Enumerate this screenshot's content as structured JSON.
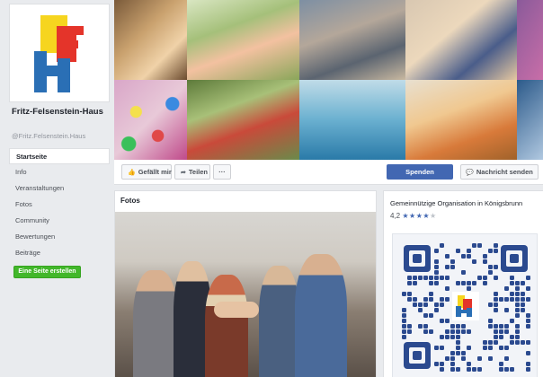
{
  "page": {
    "name": "Fritz-Felsenstein-Haus",
    "handle": "@Fritz.Felsenstein.Haus"
  },
  "nav": [
    {
      "label": "Startseite",
      "active": true
    },
    {
      "label": "Info"
    },
    {
      "label": "Veranstaltungen"
    },
    {
      "label": "Fotos"
    },
    {
      "label": "Community"
    },
    {
      "label": "Bewertungen"
    },
    {
      "label": "Beiträge"
    }
  ],
  "create_button": "Eine Seite erstellen",
  "actions": {
    "like": "Gefällt mir",
    "share": "Teilen",
    "more": "···",
    "donate": "Spenden",
    "message": "Nachricht senden"
  },
  "photos": {
    "title": "Fotos"
  },
  "info": {
    "category": "Gemeinnützige Organisation in Königsbrunn",
    "rating_value": "4,2",
    "rating_stars": 4.2
  },
  "colors": {
    "facebook_blue": "#4267b2",
    "create_green": "#42b72a",
    "logo_yellow": "#f6d51f",
    "logo_red": "#e4342a",
    "logo_blue": "#2a6fb5"
  }
}
